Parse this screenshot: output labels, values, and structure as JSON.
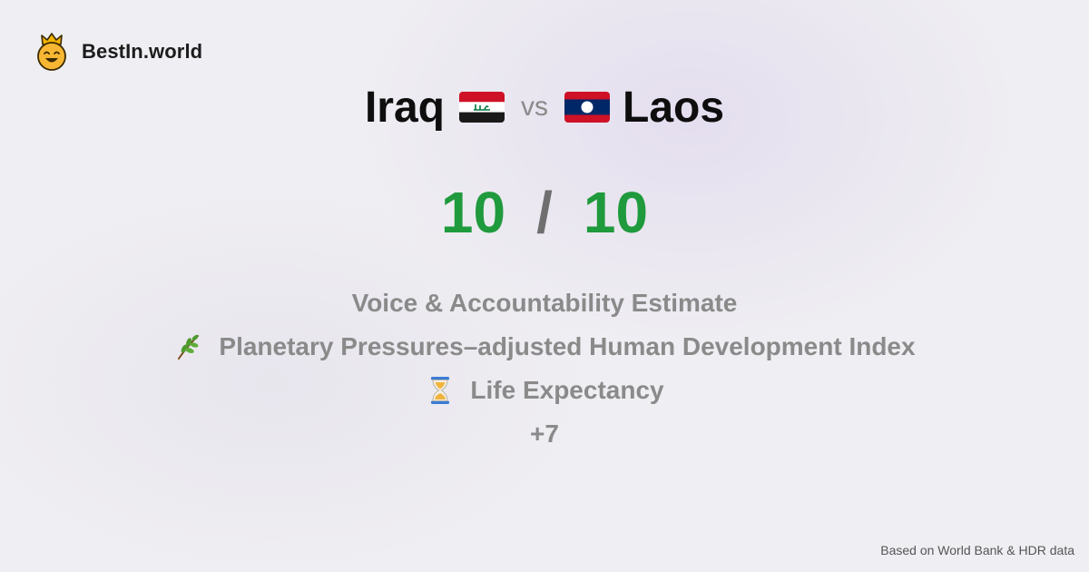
{
  "brand": {
    "name": "BestIn.world",
    "logo_icon": "crowned-smiley-icon"
  },
  "comparison": {
    "left_country": "Iraq",
    "left_flag_icon": "iraq-flag-icon",
    "vs_label": "vs",
    "right_country": "Laos",
    "right_flag_icon": "laos-flag-icon"
  },
  "score": {
    "left": "10",
    "separator": "/",
    "right": "10",
    "color": "#1f9a3c"
  },
  "metrics": [
    {
      "label": "Voice & Accountability Estimate"
    },
    {
      "icon": "herb-icon",
      "label": "Planetary Pressures–adjusted Human Development Index"
    },
    {
      "icon": "hourglass-icon",
      "label": "Life Expectancy"
    },
    {
      "label": "+7"
    }
  ],
  "footer": {
    "source": "Based on World Bank & HDR data"
  }
}
